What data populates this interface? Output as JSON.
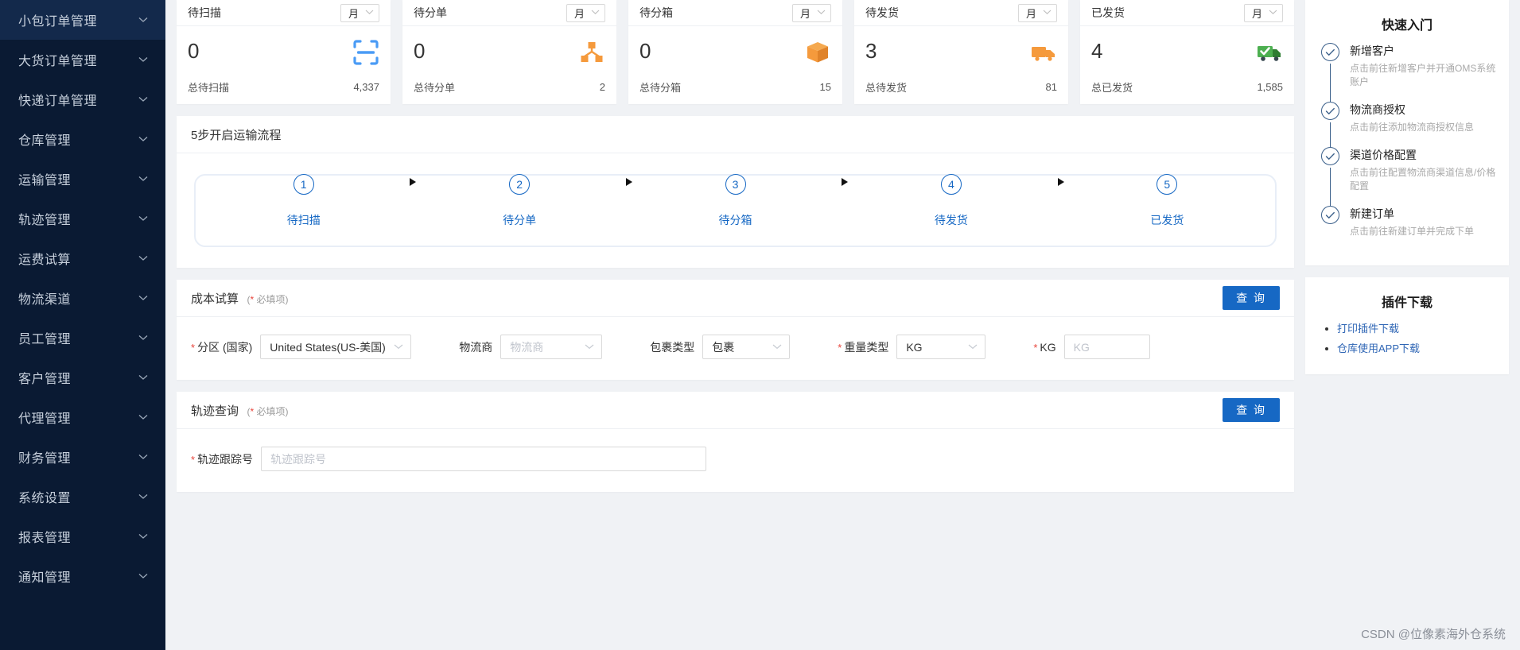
{
  "sidebar": {
    "items": [
      {
        "label": "小包订单管理",
        "icon": "chevron-down-icon"
      },
      {
        "label": "大货订单管理",
        "icon": "chevron-down-icon"
      },
      {
        "label": "快递订单管理",
        "icon": "chevron-down-icon"
      },
      {
        "label": "仓库管理",
        "icon": "chevron-down-icon"
      },
      {
        "label": "运输管理",
        "icon": "chevron-down-icon"
      },
      {
        "label": "轨迹管理",
        "icon": "chevron-down-icon"
      },
      {
        "label": "运费试算",
        "icon": "chevron-down-icon"
      },
      {
        "label": "物流渠道",
        "icon": "chevron-down-icon"
      },
      {
        "label": "员工管理",
        "icon": "chevron-down-icon"
      },
      {
        "label": "客户管理",
        "icon": "chevron-down-icon"
      },
      {
        "label": "代理管理",
        "icon": "chevron-down-icon"
      },
      {
        "label": "财务管理",
        "icon": "chevron-down-icon"
      },
      {
        "label": "系统设置",
        "icon": "chevron-down-icon"
      },
      {
        "label": "报表管理",
        "icon": "chevron-down-icon"
      },
      {
        "label": "通知管理",
        "icon": "chevron-down-icon"
      }
    ]
  },
  "stats": [
    {
      "title": "待扫描",
      "period": "月",
      "value": "0",
      "total_label": "总待扫描",
      "total_value": "4,337",
      "icon": "scan-icon",
      "icon_color": "#4a9bf5"
    },
    {
      "title": "待分单",
      "period": "月",
      "value": "0",
      "total_label": "总待分单",
      "total_value": "2",
      "icon": "split-branch-icon",
      "icon_color": "#f59a3c"
    },
    {
      "title": "待分箱",
      "period": "月",
      "value": "0",
      "total_label": "总待分箱",
      "total_value": "15",
      "icon": "box-icon",
      "icon_color": "#f59a3c"
    },
    {
      "title": "待发货",
      "period": "月",
      "value": "3",
      "total_label": "总待发货",
      "total_value": "81",
      "icon": "truck-icon",
      "icon_color": "#f59a3c"
    },
    {
      "title": "已发货",
      "period": "月",
      "value": "4",
      "total_label": "总已发货",
      "total_value": "1,585",
      "icon": "truck-check-icon",
      "icon_color": "#4caf50"
    }
  ],
  "flow": {
    "title": "5步开启运输流程",
    "steps": [
      {
        "num": "1",
        "label": "待扫描"
      },
      {
        "num": "2",
        "label": "待分单"
      },
      {
        "num": "3",
        "label": "待分箱"
      },
      {
        "num": "4",
        "label": "待发货"
      },
      {
        "num": "5",
        "label": "已发货"
      }
    ]
  },
  "cost_panel": {
    "title": "成本试算",
    "required_note_open": "(",
    "required_note_star": "*",
    "required_note_text": " 必填项)",
    "query_button": "查 询",
    "fields": {
      "country_label": "分区 (国家)",
      "country_value": "United States(US-美国)",
      "carrier_label": "物流商",
      "carrier_placeholder": "物流商",
      "carrier_value": "",
      "pkgtype_label": "包裹类型",
      "pkgtype_value": "包裹",
      "weighttype_label": "重量类型",
      "weighttype_value": "KG",
      "kg_label": "KG",
      "kg_placeholder": "KG",
      "kg_value": ""
    }
  },
  "track_panel": {
    "title": "轨迹查询",
    "required_note_open": "(",
    "required_note_star": "*",
    "required_note_text": " 必填项)",
    "query_button": "查 询",
    "field_label": "轨迹跟踪号",
    "field_placeholder": "轨迹跟踪号",
    "field_value": ""
  },
  "quick_start": {
    "title": "快速入门",
    "items": [
      {
        "title": "新增客户",
        "desc": "点击前往新增客户并开通OMS系统账户",
        "icon": "check-circle-icon"
      },
      {
        "title": "物流商授权",
        "desc": "点击前往添加物流商授权信息",
        "icon": "check-circle-icon"
      },
      {
        "title": "渠道价格配置",
        "desc": "点击前往配置物流商渠道信息/价格配置",
        "icon": "check-circle-icon"
      },
      {
        "title": "新建订单",
        "desc": "点击前往新建订单并完成下单",
        "icon": "check-circle-icon"
      }
    ]
  },
  "plugins": {
    "title": "插件下载",
    "links": [
      "打印插件下载",
      "仓库使用APP下载"
    ]
  },
  "watermark": "CSDN @位像素海外仓系统",
  "colors": {
    "sidebar_bg": "#0a1a33",
    "primary": "#1668c4",
    "accent_orange": "#f59a3c",
    "accent_green": "#4caf50",
    "accent_blue": "#4a9bf5",
    "required_red": "#e8453c"
  }
}
